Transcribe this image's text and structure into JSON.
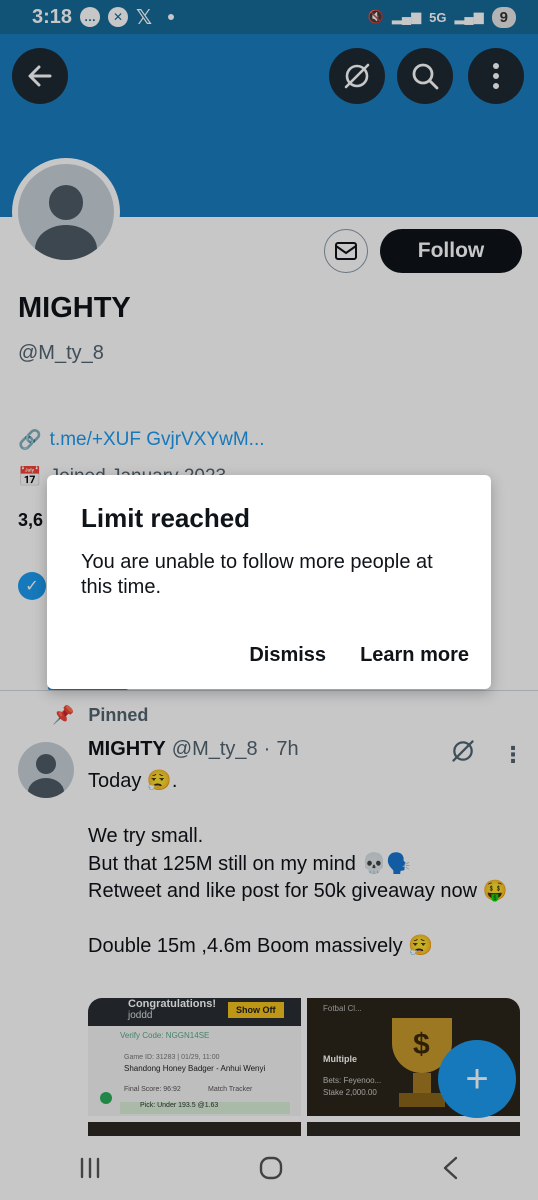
{
  "status_bar": {
    "time": "3:18",
    "network": "5G",
    "battery": "9"
  },
  "profile": {
    "display_name": "MIGHTY",
    "handle": "@M_ty_8",
    "link": "t.me/+XUF GvjrVXYwM...",
    "joined": "Joined January 2023",
    "count_fragment": "3,6",
    "follow_label": "Follow"
  },
  "pinned_label": "Pinned",
  "tweet": {
    "name": "MIGHTY",
    "handle": "@M_ty_8",
    "separator": "·",
    "time": "7h",
    "text": "Today 😮‍💨.\n\nWe try small.\nBut that 125M still on my mind 💀🗣️\nRetweet and like post for 50k giveaway now 🤑\n\nDouble 15m ,4.6m Boom massively 😮‍💨"
  },
  "media": {
    "tile_a": {
      "heading": "Congratulations!",
      "user": "joddd",
      "button": "Show Off",
      "verify": "Verify Code: NGGN14SE",
      "game": "Game ID: 31283 | 01/29, 11:00",
      "match": "Shandong Honey Badger - Anhui Wenyi",
      "score": "Final Score: 96:92",
      "tracker": "Match Tracker",
      "pick": "Pick: Under 193.5 @1.63"
    },
    "tile_b": {
      "heading": "Fotbal Cl...",
      "multiple": "Multiple",
      "bets": "Bets: Feyenoo...",
      "stake": "Stake 2,000.00"
    }
  },
  "dialog": {
    "title": "Limit reached",
    "body": "You are unable to follow more people at this time.",
    "dismiss": "Dismiss",
    "learn_more": "Learn more"
  },
  "colors": {
    "banner": "#1a7dc0",
    "accent": "#1d9bf0",
    "text": "#0f1419",
    "secondary": "#536471"
  }
}
